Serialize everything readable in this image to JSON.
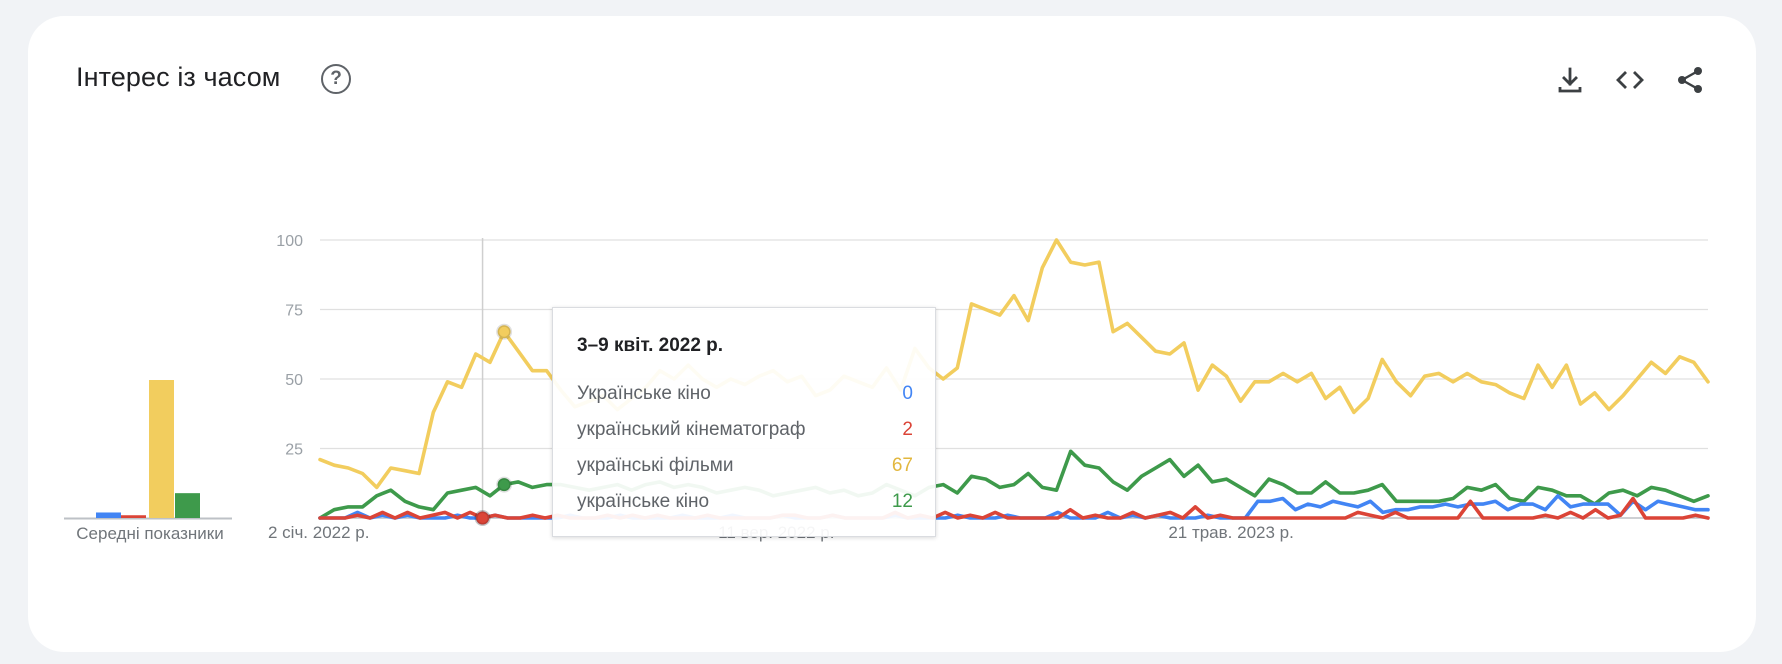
{
  "header": {
    "title": "Інтерес із часом",
    "help_symbol": "?",
    "icons": [
      "download-icon",
      "embed-code-icon",
      "share-icon"
    ]
  },
  "averages": {
    "label": "Середні показники",
    "values": [
      2,
      1,
      50,
      9
    ],
    "colors": [
      "#4285f4",
      "#db4437",
      "#f2cd5e",
      "#3e9a4b"
    ]
  },
  "tooltip": {
    "date": "3–9 квіт. 2022 р.",
    "rows": [
      {
        "name": "Українське кіно",
        "value": "0",
        "color": "#4285f4"
      },
      {
        "name": "український кінематограф",
        "value": "2",
        "color": "#db4437"
      },
      {
        "name": "українські фільми",
        "value": "67",
        "color": "#f2cd5e"
      },
      {
        "name": "українське кіно",
        "value": "12",
        "color": "#3e9a4b"
      }
    ]
  },
  "chart_data": {
    "type": "line",
    "ylim": [
      0,
      100
    ],
    "yticks": [
      25,
      50,
      75,
      100
    ],
    "grid": true,
    "x_tick_labels": [
      "2 січ. 2022 р.",
      "11 вер. 2022 р.",
      "21 трав. 2023 р."
    ],
    "x_tick_index": [
      0,
      36,
      72
    ],
    "highlight_index": 13,
    "series": [
      {
        "name": "Українське кіно",
        "color": "#4285f4",
        "values": [
          0,
          0,
          0,
          2,
          0,
          1,
          0,
          1,
          0,
          0,
          0,
          1,
          0,
          0,
          1,
          0,
          0,
          0,
          0,
          0,
          1,
          0,
          0,
          0,
          1,
          0,
          0,
          0,
          0,
          1,
          0,
          0,
          0,
          1,
          0,
          0,
          0,
          1,
          0,
          0,
          0,
          1,
          0,
          0,
          0,
          0,
          1,
          0,
          0,
          0,
          0,
          1,
          0,
          0,
          0,
          1,
          0,
          0,
          0,
          2,
          0,
          0,
          0,
          2,
          0,
          1,
          0,
          1,
          0,
          0,
          0,
          1,
          0,
          0,
          0,
          6,
          6,
          7,
          3,
          5,
          4,
          6,
          5,
          4,
          6,
          2,
          3,
          3,
          4,
          4,
          5,
          4,
          5,
          5,
          6,
          3,
          5,
          5,
          3,
          8,
          4,
          5,
          5,
          5,
          1,
          6,
          3,
          6,
          5,
          4,
          3,
          3
        ]
      },
      {
        "name": "український кінематограф",
        "color": "#db4437",
        "values": [
          0,
          0,
          0,
          1,
          0,
          2,
          0,
          2,
          0,
          1,
          2,
          0,
          2,
          0,
          1,
          0,
          0,
          1,
          0,
          1,
          0,
          0,
          0,
          1,
          0,
          1,
          0,
          1,
          0,
          0,
          0,
          1,
          0,
          0,
          0,
          0,
          0,
          1,
          1,
          0,
          0,
          1,
          0,
          0,
          0,
          0,
          2,
          0,
          1,
          0,
          2,
          0,
          1,
          0,
          2,
          0,
          0,
          0,
          0,
          0,
          3,
          0,
          1,
          0,
          0,
          2,
          0,
          1,
          2,
          0,
          4,
          0,
          1,
          0,
          0,
          0,
          0,
          0,
          0,
          0,
          0,
          0,
          0,
          2,
          1,
          0,
          2,
          0,
          0,
          0,
          0,
          0,
          6,
          0,
          0,
          0,
          0,
          0,
          1,
          0,
          2,
          0,
          3,
          0,
          1,
          7,
          0,
          0,
          0,
          0,
          1,
          0
        ]
      },
      {
        "name": "українські фільми",
        "color": "#f2cd5e",
        "values": [
          21,
          19,
          18,
          16,
          11,
          18,
          17,
          16,
          38,
          49,
          47,
          59,
          56,
          67,
          60,
          53,
          53,
          46,
          40,
          42,
          44,
          39,
          43,
          47,
          53,
          50,
          55,
          50,
          47,
          50,
          48,
          51,
          53,
          49,
          51,
          44,
          46,
          51,
          49,
          47,
          54,
          46,
          61,
          54,
          50,
          54,
          77,
          75,
          73,
          80,
          71,
          90,
          100,
          92,
          91,
          92,
          67,
          70,
          65,
          60,
          59,
          63,
          46,
          55,
          51,
          42,
          49,
          49,
          52,
          49,
          52,
          43,
          47,
          38,
          43,
          57,
          49,
          44,
          51,
          52,
          49,
          52,
          49,
          48,
          45,
          43,
          55,
          47,
          55,
          41,
          45,
          39,
          44,
          50,
          56,
          52,
          58,
          56,
          49
        ]
      },
      {
        "name": "українське кіно",
        "color": "#3e9a4b",
        "values": [
          0,
          3,
          4,
          4,
          8,
          10,
          6,
          4,
          3,
          9,
          10,
          11,
          8,
          12,
          13,
          11,
          12,
          12,
          11,
          10,
          11,
          12,
          10,
          12,
          13,
          11,
          12,
          11,
          9,
          10,
          11,
          10,
          8,
          9,
          10,
          11,
          9,
          10,
          8,
          9,
          12,
          10,
          8,
          11,
          12,
          9,
          15,
          14,
          11,
          12,
          16,
          11,
          10,
          24,
          19,
          18,
          13,
          10,
          15,
          18,
          21,
          15,
          19,
          13,
          14,
          11,
          8,
          14,
          12,
          9,
          9,
          13,
          9,
          9,
          10,
          12,
          6,
          6,
          6,
          6,
          7,
          11,
          10,
          12,
          7,
          6,
          11,
          10,
          8,
          8,
          5,
          9,
          10,
          8,
          11,
          10,
          8,
          6,
          8
        ]
      }
    ]
  }
}
